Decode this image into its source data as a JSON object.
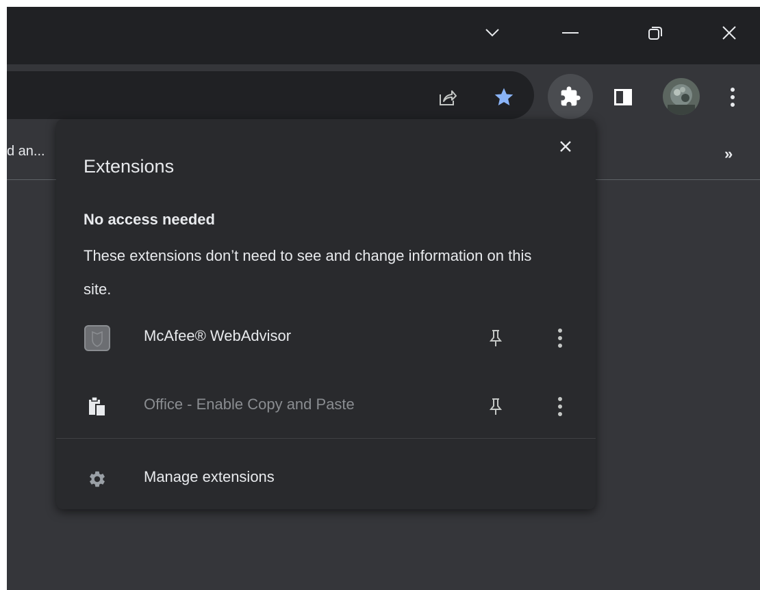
{
  "bookmarks_bar": {
    "truncated_item": "d an...",
    "overflow_label": "»"
  },
  "toolbar": {
    "icons": [
      "share-icon",
      "bookmark-star-icon",
      "extensions-puzzle-icon",
      "side-panel-icon",
      "profile-avatar",
      "more-vertical-icon"
    ],
    "star_color": "#8ab4f8"
  },
  "titlebar": {
    "icons": [
      "tab-search-chevron-icon",
      "minimize-icon",
      "restore-icon",
      "close-icon"
    ]
  },
  "popup": {
    "title": "Extensions",
    "section_heading": "No access needed",
    "section_description": "These extensions don’t need to see and change information on this site.",
    "extensions": [
      {
        "name": "McAfee® WebAdvisor",
        "icon": "mcafee-shield-icon",
        "enabled": true
      },
      {
        "name": "Office - Enable Copy and Paste",
        "icon": "clipboard-paste-icon",
        "enabled": false
      }
    ],
    "manage_label": "Manage extensions"
  },
  "colors": {
    "titlebar_bg": "#202124",
    "toolbar_bg": "#35363a",
    "popup_bg": "#292a2d",
    "text": "#e8eaed",
    "dim_text": "#8a8d91",
    "accent": "#8ab4f8"
  }
}
